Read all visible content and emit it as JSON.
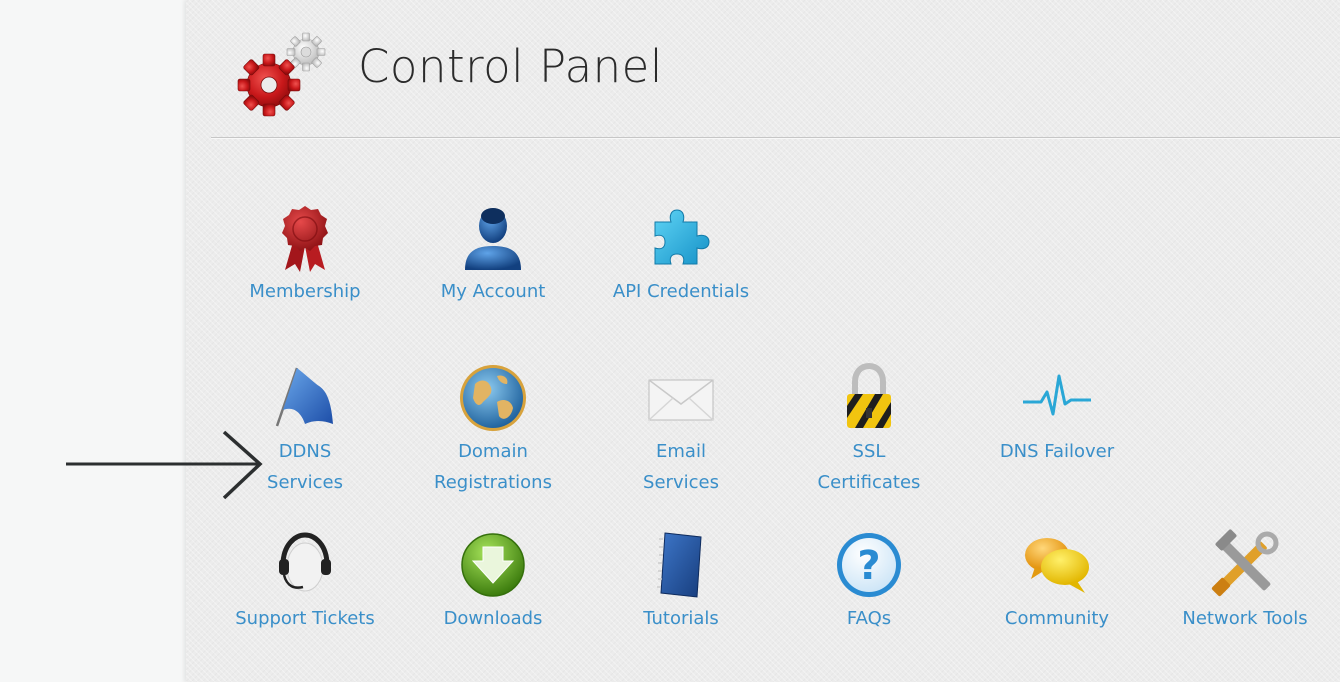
{
  "header": {
    "title": "Control Panel"
  },
  "rows": [
    [
      {
        "id": "membership",
        "label": "Membership",
        "icon": "ribbon-icon"
      },
      {
        "id": "my-account",
        "label": "My Account",
        "icon": "user-icon"
      },
      {
        "id": "api-credentials",
        "label": "API Credentials",
        "icon": "puzzle-icon"
      }
    ],
    [
      {
        "id": "ddns-services",
        "label": "DDNS Services",
        "line1": "DDNS",
        "line2": "Services",
        "icon": "flag-icon"
      },
      {
        "id": "domain-registrations",
        "label": "Domain Registrations",
        "line1": "Domain",
        "line2": "Registrations",
        "icon": "globe-icon"
      },
      {
        "id": "email-services",
        "label": "Email Services",
        "line1": "Email",
        "line2": "Services",
        "icon": "envelope-icon"
      },
      {
        "id": "ssl-certificates",
        "label": "SSL Certificates",
        "line1": "SSL",
        "line2": "Certificates",
        "icon": "padlock-icon"
      },
      {
        "id": "dns-failover",
        "label": "DNS Failover",
        "icon": "pulse-icon"
      }
    ],
    [
      {
        "id": "support-tickets",
        "label": "Support Tickets",
        "icon": "headset-icon"
      },
      {
        "id": "downloads",
        "label": "Downloads",
        "icon": "download-icon"
      },
      {
        "id": "tutorials",
        "label": "Tutorials",
        "icon": "notebook-icon"
      },
      {
        "id": "faqs",
        "label": "FAQs",
        "icon": "question-icon"
      },
      {
        "id": "community",
        "label": "Community",
        "icon": "chat-bubbles-icon"
      },
      {
        "id": "network-tools",
        "label": "Network Tools",
        "icon": "tools-icon"
      }
    ]
  ],
  "colors": {
    "link": "#3a8fc9",
    "title": "#2b2b2b",
    "arrow": "#2c2f30"
  }
}
